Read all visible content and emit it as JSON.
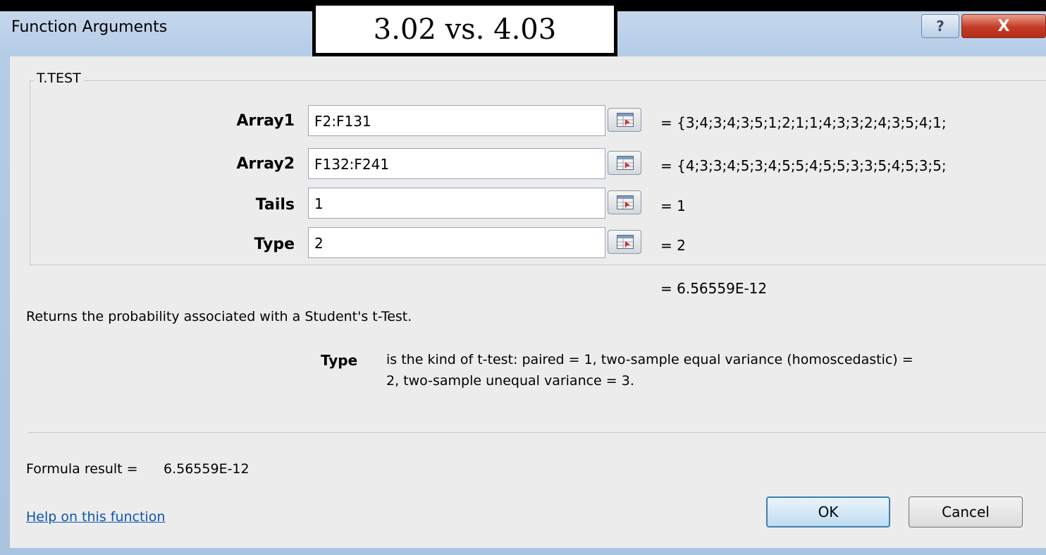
{
  "window": {
    "title": "Function Arguments",
    "overlay_note": "3.02 vs. 4.03"
  },
  "function_group": {
    "name": "T.TEST",
    "arguments": [
      {
        "label": "Array1",
        "value": "F2:F131",
        "result": "=  {3;4;3;4;3;5;1;2;1;1;4;3;3;2;4;3;5;4;1;"
      },
      {
        "label": "Array2",
        "value": "F132:F241",
        "result": "=  {4;3;3;4;5;3;4;5;5;4;5;5;3;3;5;4;5;3;5;"
      },
      {
        "label": "Tails",
        "value": "1",
        "result": "=  1"
      },
      {
        "label": "Type",
        "value": "2",
        "result": "=  2"
      }
    ]
  },
  "function_result": "=  6.56559E-12",
  "description": "Returns the probability associated with a Student's t-Test.",
  "arg_help": {
    "name": "Type",
    "line1": "is the kind of t-test: paired = 1, two-sample equal variance (homoscedastic) =",
    "line2": "2, two-sample unequal variance = 3."
  },
  "formula_result": {
    "label": "Formula result =",
    "value": "6.56559E-12"
  },
  "help_link": "Help on this function",
  "buttons": {
    "ok": "OK",
    "cancel": "Cancel",
    "help": "?",
    "close": "X"
  },
  "icons": {
    "collapse_dialog": "range-select-icon",
    "help": "question-icon",
    "close": "close-icon"
  }
}
